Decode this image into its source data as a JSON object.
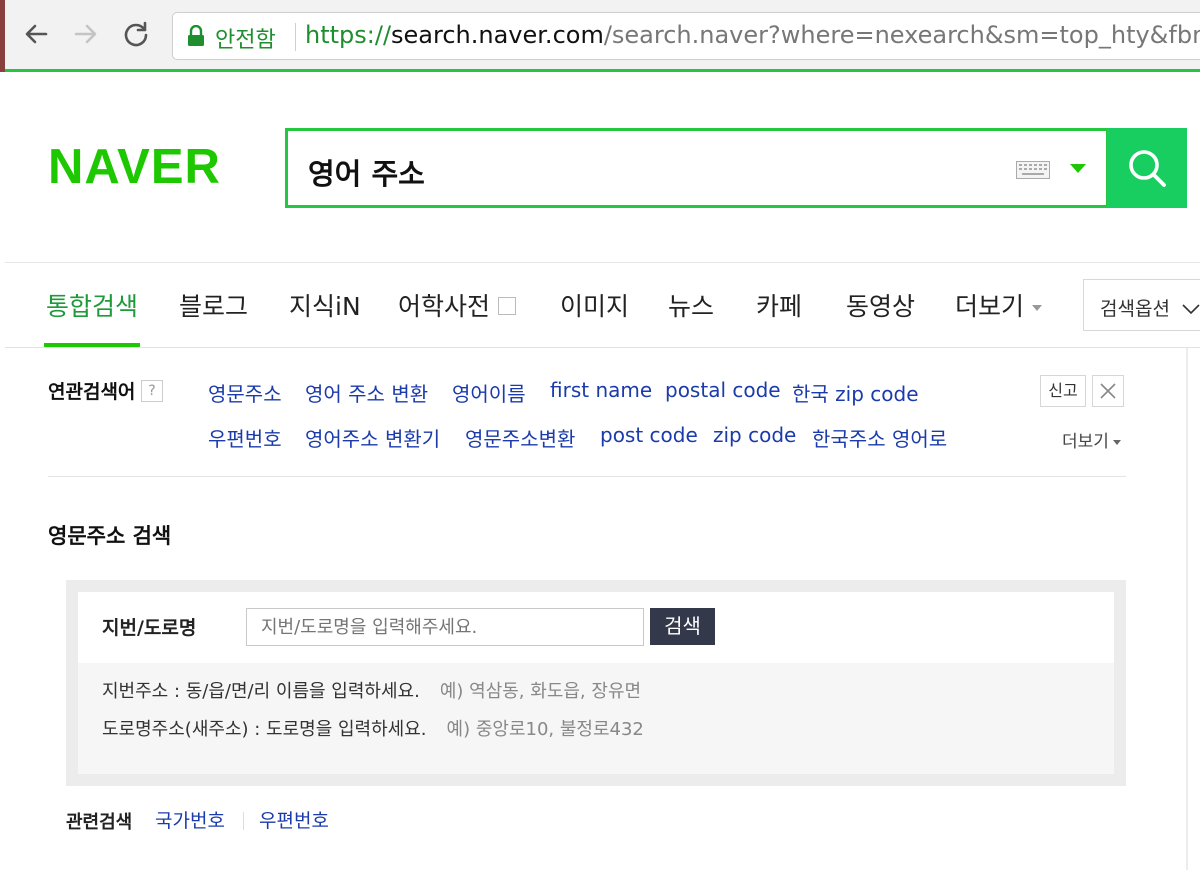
{
  "browser": {
    "security_label": "안전함",
    "url_scheme": "https://",
    "url_host": "search.naver.com",
    "url_path": "/search.naver?where=nexearch&sm=top_hty&fbm=..."
  },
  "header": {
    "logo_text": "NAVER",
    "search_query": "영어 주소"
  },
  "tabs": [
    {
      "label": "통합검색"
    },
    {
      "label": "블로그"
    },
    {
      "label": "지식iN"
    },
    {
      "label": "어학사전"
    },
    {
      "label": "이미지"
    },
    {
      "label": "뉴스"
    },
    {
      "label": "카페"
    },
    {
      "label": "동영상"
    },
    {
      "label": "더보기"
    }
  ],
  "search_options_label": "검색옵션",
  "related_keywords": {
    "title": "연관검색어",
    "help": "?",
    "row1": [
      "영문주소",
      "영어 주소 변환",
      "영어이름",
      "first name",
      "postal code",
      "한국 zip code"
    ],
    "row2": [
      "우편번호",
      "영어주소 변환기",
      "영문주소변환",
      "post code",
      "zip code",
      "한국주소 영어로"
    ],
    "report_label": "신고",
    "more_label": "더보기"
  },
  "english_address": {
    "title": "영문주소 검색",
    "field_label": "지번/도로명",
    "input_placeholder": "지번/도로명을 입력해주세요.",
    "button_label": "검색",
    "help": [
      {
        "text": "지번주소 : 동/읍/면/리 이름을 입력하세요.",
        "example": "예) 역삼동, 화도읍, 장유면"
      },
      {
        "text": "도로명주소(새주소) : 도로명을 입력하세요.",
        "example": "예) 중앙로10, 불정로432"
      }
    ]
  },
  "related_search": {
    "title": "관련검색",
    "links": [
      "국가번호",
      "우편번호"
    ]
  },
  "colors": {
    "naver_green": "#1ec800",
    "search_button": "#19ce60",
    "link_blue": "#1b3bab",
    "dark_button": "#33394a"
  },
  "icons": [
    "back-arrow-icon",
    "forward-arrow-icon",
    "reload-icon",
    "lock-icon",
    "keyboard-icon",
    "search-icon",
    "close-icon"
  ]
}
